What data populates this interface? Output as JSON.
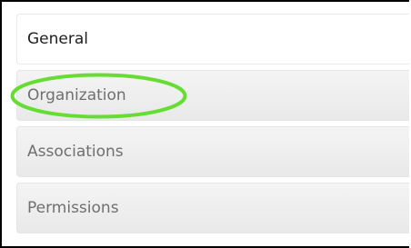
{
  "tabs": [
    {
      "label": "General",
      "active": true
    },
    {
      "label": "Organization",
      "active": false
    },
    {
      "label": "Associations",
      "active": false
    },
    {
      "label": "Permissions",
      "active": false
    }
  ],
  "annotation": {
    "shape": "ellipse",
    "color": "#66dd33",
    "target": "Organization"
  },
  "colors": {
    "active_tab_bg": "#ffffff",
    "inactive_tab_bg": "#ececec",
    "active_text": "#1e1e1e",
    "inactive_text": "#6f6f6f",
    "frame_border": "#000000"
  }
}
